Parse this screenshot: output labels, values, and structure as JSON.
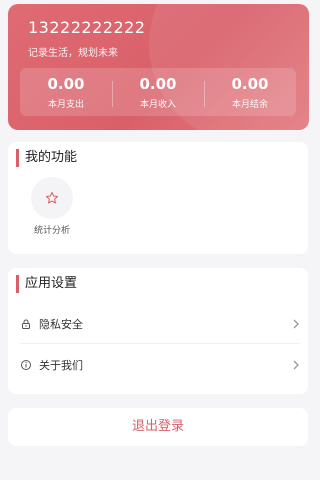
{
  "profile": {
    "phone": "13222222222",
    "slogan": "记录生活，规划未来"
  },
  "stats": [
    {
      "value": "0.00",
      "label": "本月支出"
    },
    {
      "value": "0.00",
      "label": "本月收入"
    },
    {
      "value": "0.00",
      "label": "本月结余"
    }
  ],
  "functions": {
    "title": "我的功能",
    "items": [
      {
        "label": "统计分析",
        "icon": "star-icon"
      }
    ]
  },
  "settings": {
    "title": "应用设置",
    "items": [
      {
        "label": "隐私安全",
        "icon": "lock-icon"
      },
      {
        "label": "关于我们",
        "icon": "info-icon"
      }
    ]
  },
  "logout": {
    "label": "退出登录"
  },
  "colors": {
    "accent": "#d9606a",
    "background": "#f5f5f7"
  }
}
